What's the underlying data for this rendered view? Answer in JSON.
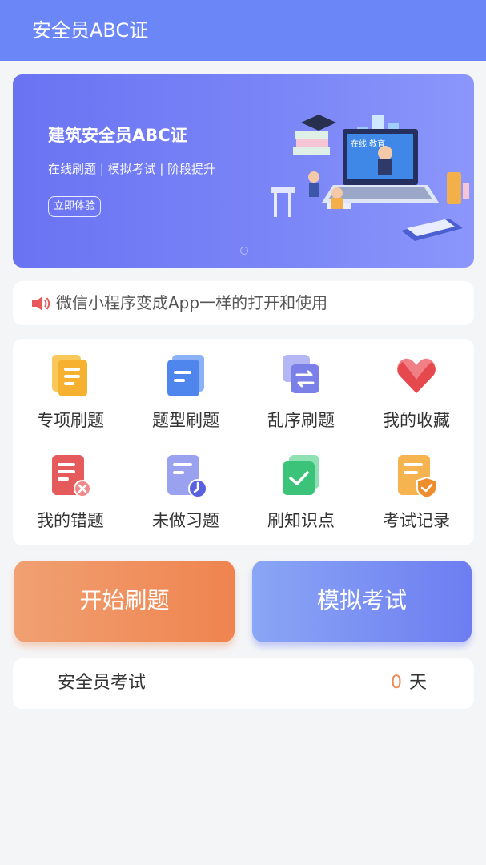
{
  "app": {
    "title": "安全员ABC证"
  },
  "banner": {
    "title": "建筑安全员ABC证",
    "subtitle": "在线刷题 | 模拟考试 | 阶段提升",
    "button_label": "立即体验",
    "screen_text": "在线 教育"
  },
  "notice": {
    "text": "微信小程序变成App一样的打开和使用",
    "icon": "speaker-icon"
  },
  "menu": {
    "items": [
      {
        "label": "专项刷题",
        "icon": "document-icon",
        "color": "#f5b83d"
      },
      {
        "label": "题型刷题",
        "icon": "document-stack-icon",
        "color": "#4f86ee"
      },
      {
        "label": "乱序刷题",
        "icon": "shuffle-icon",
        "color": "#7b7fe8"
      },
      {
        "label": "我的收藏",
        "icon": "heart-icon",
        "color": "#e5484d"
      },
      {
        "label": "我的错题",
        "icon": "wrong-doc-icon",
        "color": "#e55a5a"
      },
      {
        "label": "未做习题",
        "icon": "pending-doc-icon",
        "color": "#7b86ee"
      },
      {
        "label": "刷知识点",
        "icon": "check-icon",
        "color": "#3cc37a"
      },
      {
        "label": "考试记录",
        "icon": "record-icon",
        "color": "#f3a03c"
      }
    ]
  },
  "actions": {
    "start_label": "开始刷题",
    "mock_label": "模拟考试"
  },
  "countdown": {
    "title": "安全员考试",
    "days": "0",
    "unit": "天"
  },
  "colors": {
    "header": "#6b86f7",
    "accent_orange": "#ef844f",
    "accent_blue": "#6d7df1"
  }
}
